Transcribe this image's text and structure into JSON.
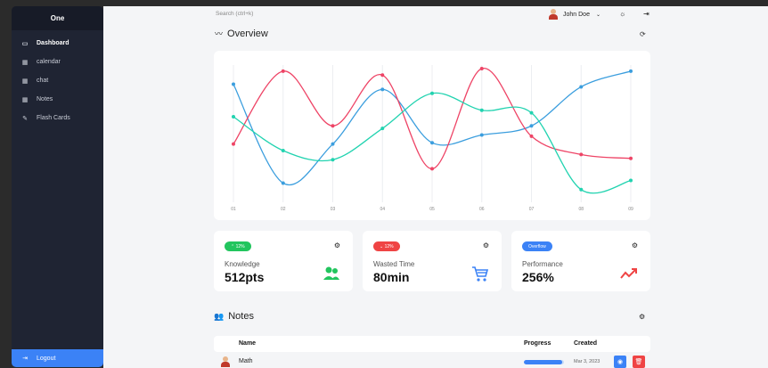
{
  "sidebar": {
    "brand": "One",
    "items": [
      {
        "label": "Dashboard",
        "icon": "monitor-icon",
        "glyph": "▭"
      },
      {
        "label": "calendar",
        "icon": "calendar-icon",
        "glyph": "▦"
      },
      {
        "label": "chat",
        "icon": "chat-icon",
        "glyph": "▦"
      },
      {
        "label": "Notes",
        "icon": "notes-icon",
        "glyph": "▦"
      },
      {
        "label": "Flash Cards",
        "icon": "edit-icon",
        "glyph": "✎"
      }
    ],
    "logout_label": "Logout",
    "logout_glyph": "⇥"
  },
  "topbar": {
    "search_placeholder": "Search (ctrl+k)",
    "user_name": "John Doe",
    "caret": "⌄",
    "theme_glyph": "☼",
    "signout_glyph": "⇥"
  },
  "overview": {
    "title": "Overview",
    "icon_glyph": "〰",
    "refresh_glyph": "⟳"
  },
  "chart_data": {
    "type": "line",
    "categories": [
      "01",
      "02",
      "03",
      "04",
      "05",
      "06",
      "07",
      "08",
      "09"
    ],
    "series": [
      {
        "color": "#3b9ede",
        "values": [
          88,
          12,
          42,
          84,
          43,
          49,
          56,
          86,
          98
        ]
      },
      {
        "color": "#ee4466",
        "values": [
          42,
          98,
          56,
          95,
          23,
          100,
          48,
          34,
          31
        ]
      },
      {
        "color": "#22d3b0",
        "values": [
          63,
          37,
          30,
          54,
          81,
          68,
          66,
          7,
          14
        ]
      }
    ],
    "ylim": [
      0,
      100
    ],
    "grid": true
  },
  "stats": [
    {
      "badge": "⌃ 12%",
      "badge_color": "#22c55e",
      "label": "Knowledge",
      "value": "512pts",
      "icon": "users-icon",
      "icon_color": "#22c55e"
    },
    {
      "badge": "⌄ 12%",
      "badge_color": "#ef4444",
      "label": "Wasted Time",
      "value": "80min",
      "icon": "cart-icon",
      "icon_color": "#3b82f6"
    },
    {
      "badge": "Overflow",
      "badge_color": "#3b82f6",
      "label": "Performance",
      "value": "256%",
      "icon": "trend-icon",
      "icon_color": "#ef4444"
    }
  ],
  "gear_glyph": "⚙",
  "notes": {
    "title": "Notes",
    "icon_glyph": "👥",
    "columns": {
      "name": "Name",
      "progress": "Progress",
      "created": "Created"
    },
    "rows": [
      {
        "name": "Math",
        "progress": 0.95,
        "created": "Mar 3, 2023",
        "view_glyph": "◉",
        "delete_glyph": "🗑"
      }
    ]
  }
}
